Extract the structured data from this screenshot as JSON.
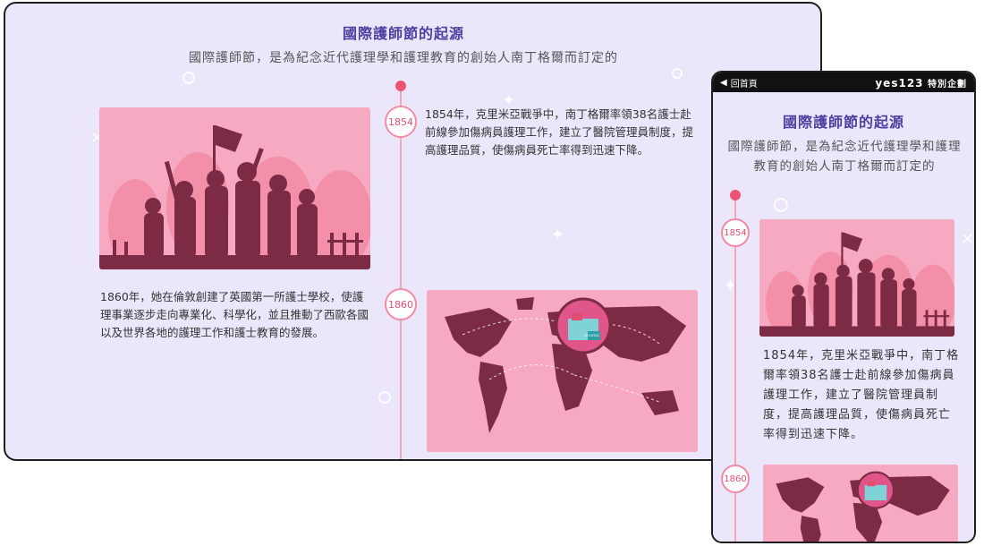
{
  "desktop": {
    "title": "國際護師節的起源",
    "subtitle": "國際護師節，是為紀念近代護理學和護理教育的創始人南丁格爾而訂定的",
    "timeline": [
      {
        "year": "1854",
        "text": "1854年，克里米亞戰爭中，南丁格爾率領38名護士赴前線參加傷病員護理工作，建立了醫院管理員制度，提高護理品質，使傷病員死亡率得到迅速下降。"
      },
      {
        "year": "1860",
        "text": "1860年，她在倫敦創建了英國第一所護士學校，使護理事業逐步走向專業化、科學化，並且推動了西歐各國以及世界各地的護理工作和護士教育的發展。"
      }
    ],
    "school_sign": "SCHOOL"
  },
  "mobile": {
    "back_label": "回首頁",
    "brand": "yes123",
    "brand_suffix": "特別企劃",
    "title": "國際護師節的起源",
    "subtitle": "國際護師節，是為紀念近代護理學和護理教育的創始人南丁格爾而訂定的",
    "timeline": [
      {
        "year": "1854",
        "text": "1854年，克里米亞戰爭中，南丁格爾率領38名護士赴前線參加傷病員護理工作，建立了醫院管理員制度，提高護理品質，使傷病員死亡率得到迅速下降。"
      },
      {
        "year": "1860"
      }
    ]
  },
  "colors": {
    "background": "#ece6fb",
    "title": "#4b3fa0",
    "accent": "#ea5477",
    "timeline": "#f4a5b7",
    "image_bg": "#f6a9c0",
    "silhouette": "#7d2b44"
  },
  "icons": [
    "back-arrow-icon",
    "protest-silhouette-illustration",
    "world-map-illustration",
    "school-building-icon"
  ]
}
